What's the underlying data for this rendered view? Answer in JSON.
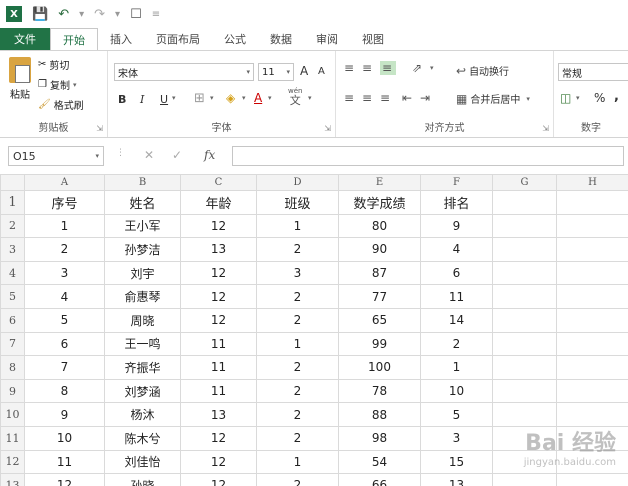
{
  "qat": {
    "logo": "X",
    "save_icon": "save-icon",
    "undo_icon": "undo-icon",
    "redo_icon": "redo-icon",
    "preview_icon": "print-preview-icon"
  },
  "tabs": [
    {
      "label": "文件"
    },
    {
      "label": "开始"
    },
    {
      "label": "插入"
    },
    {
      "label": "页面布局"
    },
    {
      "label": "公式"
    },
    {
      "label": "数据"
    },
    {
      "label": "审阅"
    },
    {
      "label": "视图"
    }
  ],
  "ribbon": {
    "clipboard": {
      "paste": "粘贴",
      "cut": "剪切",
      "copy": "复制",
      "format_painter": "格式刷",
      "label": "剪贴板"
    },
    "font": {
      "name": "宋体",
      "size": "11",
      "grow": "A",
      "shrink": "A",
      "bold": "B",
      "italic": "I",
      "underline": "U",
      "wen": "wén",
      "wen_char": "文",
      "label": "字体"
    },
    "align": {
      "wrap": "自动换行",
      "merge": "合并后居中",
      "label": "对齐方式"
    },
    "number": {
      "format": "常规",
      "percent": "%",
      "comma": ",",
      "label": "数字"
    }
  },
  "formula_bar": {
    "cell_ref": "O15",
    "fx": "fx",
    "value": ""
  },
  "sheet": {
    "columns": [
      "A",
      "B",
      "C",
      "D",
      "E",
      "F",
      "G",
      "H"
    ],
    "header_row": [
      "序号",
      "姓名",
      "年龄",
      "班级",
      "数学成绩",
      "排名",
      "",
      ""
    ],
    "rows": [
      [
        "1",
        "王小军",
        "12",
        "1",
        "80",
        "9",
        "",
        ""
      ],
      [
        "2",
        "孙梦洁",
        "13",
        "2",
        "90",
        "4",
        "",
        ""
      ],
      [
        "3",
        "刘宇",
        "12",
        "3",
        "87",
        "6",
        "",
        ""
      ],
      [
        "4",
        "俞惠琴",
        "12",
        "2",
        "77",
        "11",
        "",
        ""
      ],
      [
        "5",
        "周晓",
        "12",
        "2",
        "65",
        "14",
        "",
        ""
      ],
      [
        "6",
        "王一鸣",
        "11",
        "1",
        "99",
        "2",
        "",
        ""
      ],
      [
        "7",
        "齐振华",
        "11",
        "2",
        "100",
        "1",
        "",
        ""
      ],
      [
        "8",
        "刘梦涵",
        "11",
        "2",
        "78",
        "10",
        "",
        ""
      ],
      [
        "9",
        "杨沐",
        "13",
        "2",
        "88",
        "5",
        "",
        ""
      ],
      [
        "10",
        "陈木兮",
        "12",
        "2",
        "98",
        "3",
        "",
        ""
      ],
      [
        "11",
        "刘佳怡",
        "12",
        "1",
        "54",
        "15",
        "",
        ""
      ],
      [
        "12",
        "孙晓",
        "12",
        "2",
        "66",
        "13",
        "",
        ""
      ]
    ],
    "row_numbers": [
      "1",
      "2",
      "3",
      "4",
      "5",
      "6",
      "7",
      "8",
      "9",
      "10",
      "11",
      "12",
      "13"
    ]
  },
  "watermark": {
    "main": "Bai 经验",
    "sub": "jingyan.baidu.com"
  }
}
